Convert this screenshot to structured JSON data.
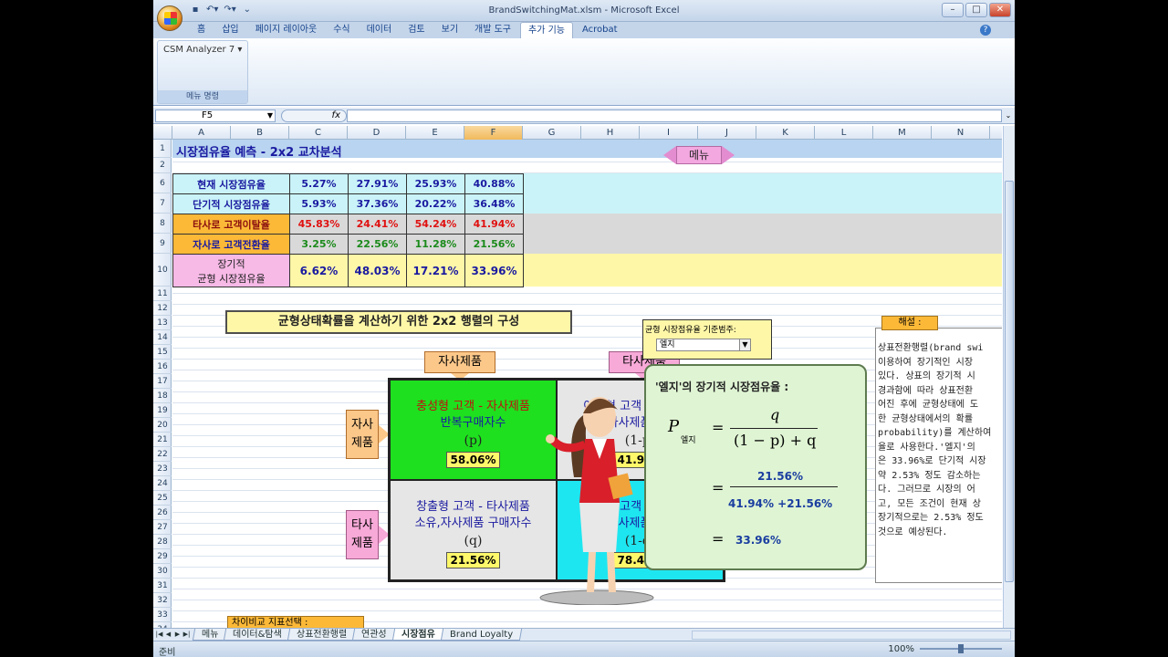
{
  "window": {
    "title": "BrandSwitchingMat.xlsm - Microsoft Excel",
    "controls": [
      "–",
      "□",
      "✕"
    ]
  },
  "ribbon": {
    "tabs": [
      "홈",
      "삽입",
      "페이지 레이아웃",
      "수식",
      "데이터",
      "검토",
      "보기",
      "개발 도구",
      "추가 기능",
      "Acrobat"
    ],
    "active_tab": "추가 기능",
    "addin_button": "CSM Analyzer 7",
    "group_label": "메뉴 명령"
  },
  "formula_bar": {
    "name_box": "F5",
    "fx": "fx",
    "value": ""
  },
  "columns": [
    "A",
    "B",
    "C",
    "D",
    "E",
    "F",
    "G",
    "H",
    "I",
    "J",
    "K",
    "L",
    "M",
    "N"
  ],
  "selected_column": "F",
  "rows": [
    "1",
    "2",
    "6",
    "7",
    "8",
    "9",
    "10",
    "11",
    "12",
    "13",
    "14",
    "15",
    "16",
    "17",
    "18",
    "19",
    "20",
    "21",
    "22",
    "23",
    "24",
    "25",
    "26",
    "27",
    "28",
    "29",
    "30",
    "31",
    "32",
    "33",
    "34",
    "35",
    "36",
    "37"
  ],
  "sheet": {
    "title": "시장점유율 예측 - 2x2 교차분석",
    "menu_button": "메뉴",
    "table": [
      {
        "label": "현재 시장점유율",
        "values": [
          "5.27%",
          "27.91%",
          "25.93%",
          "40.88%"
        ],
        "style": "cyan",
        "color": "#1a1aa0"
      },
      {
        "label": "단기적 시장점유율",
        "values": [
          "5.93%",
          "37.36%",
          "20.22%",
          "36.48%"
        ],
        "style": "cyan",
        "color": "#1a1aa0"
      },
      {
        "label": "타사로 고객이탈율",
        "values": [
          "45.83%",
          "24.41%",
          "54.24%",
          "41.94%"
        ],
        "style": "gray",
        "color": "#e01010",
        "label_bg": "#fcb938"
      },
      {
        "label": "자사로 고객전환율",
        "values": [
          "3.25%",
          "22.56%",
          "11.28%",
          "21.56%"
        ],
        "style": "gray",
        "color": "#1a8a1a",
        "label_bg": "#fcb938"
      },
      {
        "label_line1": "장기적",
        "label_line2": "균형 시장점유율",
        "values": [
          "6.62%",
          "48.03%",
          "17.21%",
          "33.96%"
        ],
        "style": "yellow",
        "color": "#1a1aa0",
        "label_bg": "#f7b9e6"
      }
    ],
    "matrix_banner": "균형상태확률을 계산하기 위한 2x2 행렬의 구성",
    "col_labels": [
      "자사제품",
      "타사제품"
    ],
    "row_labels": [
      [
        "자사",
        "제품"
      ],
      [
        "타사",
        "제품"
      ]
    ],
    "cells": [
      {
        "l1": "충성형 고객 - 자사제품",
        "l2": "반복구매자수",
        "l3": "(p)",
        "pct": "58.06%",
        "bg": "#1ee01e",
        "c1": "#c01010",
        "c2": "#1a1aa0"
      },
      {
        "l1": "이탈형 고객 - 자사제품",
        "l2": "소유,타사제품 구매자수",
        "l3": "(1-p)",
        "pct": "41.94%",
        "bg": "#e6e6e6",
        "c1": "#1a1aa0",
        "c2": "#1a1aa0"
      },
      {
        "l1": "창출형 고객 - 타사제품",
        "l2": "소유,자사제품 구매자수",
        "l3": "(q)",
        "pct": "21.56%",
        "bg": "#e6e6e6",
        "c1": "#1a1aa0",
        "c2": "#1a1aa0"
      },
      {
        "l1": "포기형 고객 - 타사제품",
        "l2": "소유,타사제품 구매자수",
        "l3": "(1-q)",
        "pct": "78.44%",
        "bg": "#1ee6f0",
        "c1": "#1a1aa0",
        "c2": "#1a1aa0"
      }
    ],
    "selector": {
      "label": "균형 시장점유율 기준범주:",
      "value": "엘지"
    },
    "formula": {
      "heading": "'엘지'의 장기적 시장점유율 :",
      "P": "P",
      "sub": "엘지",
      "eq": "=",
      "num": "q",
      "den": "(1 − p) + q",
      "num2": "21.56%",
      "den2": "41.94% +21.56%",
      "result": "33.96%"
    },
    "comment_tag": "해설 :",
    "comment_lines": [
      "상표전환행렬(brand swi",
      "이용하여 장기적인 시장",
      "있다. 상표의 장기적 시",
      "경과함에 따라 상표전환",
      "어진 후에 균형상태에 도",
      "한 균형상태에서의 확률",
      "probability)를 계산하여",
      "율로 사용한다.'엘지'의",
      "은 33.96%로 단기적 시장",
      "약 2.53% 정도 감소하는",
      "다. 그러므로 시장의 어",
      "고, 모든 조건이 현재 상",
      "장기적으로는 2.53% 정도",
      "것으로 예상된다."
    ],
    "diff_selector": "차이비교 지표선택 :"
  },
  "sheet_tabs": [
    "메뉴",
    "데이터&탐색",
    "상표전환행렬",
    "연관성",
    "시장점유",
    "Brand Loyalty"
  ],
  "active_sheet": "시장점유",
  "status": {
    "ready": "준비",
    "zoom": "100%"
  },
  "colors": {
    "accent": "#15428b",
    "band": "#b8d4f0"
  }
}
